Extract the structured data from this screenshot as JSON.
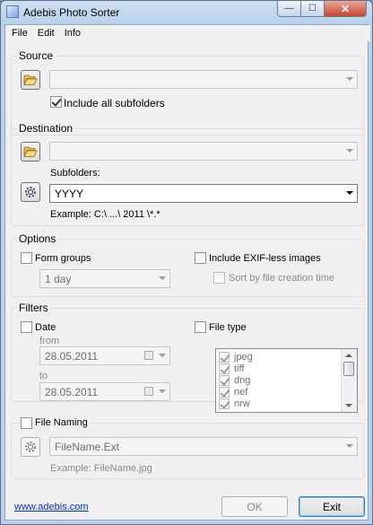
{
  "window": {
    "title": "Adebis Photo Sorter",
    "min_glyph": "—",
    "max_glyph": "☐",
    "close_glyph": "✕"
  },
  "menu": [
    "File",
    "Edit",
    "Info"
  ],
  "source": {
    "legend": "Source",
    "path_value": "",
    "include_subfolders_label": "Include all subfolders",
    "include_subfolders_checked": true
  },
  "destination": {
    "legend": "Destination",
    "path_value": "",
    "subfolders_label": "Subfolders:",
    "subfolders_value": "YYYY",
    "example": "Example: C:\\ ...\\ 2011 \\*.*"
  },
  "options": {
    "legend": "Options",
    "form_groups_label": "Form groups",
    "group_interval": "1 day",
    "include_exifless_label": "Include EXIF-less images",
    "sort_by_creation_label": "Sort by file creation time"
  },
  "filters": {
    "legend": "Filters",
    "date_label": "Date",
    "from_label": "from",
    "from_value": "28.05.2011",
    "to_label": "to",
    "to_value": "28.05.2011",
    "filetype_label": "File type",
    "file_types": [
      "jpeg",
      "tiff",
      "dng",
      "nef",
      "nrw"
    ]
  },
  "file_naming": {
    "legend": "File Naming",
    "pattern_value": "FileName.Ext",
    "example": "Example: FileName.jpg"
  },
  "footer": {
    "link": "www.adebis.com",
    "ok_label": "OK",
    "exit_label": "Exit"
  },
  "icons": {
    "folder": "folder-open-icon",
    "gear": "gear-icon",
    "calendar": "calendar-icon"
  },
  "colors": {
    "link": "#0033cc",
    "title_bar": "#b9d1ea",
    "close_button": "#c8452c"
  }
}
